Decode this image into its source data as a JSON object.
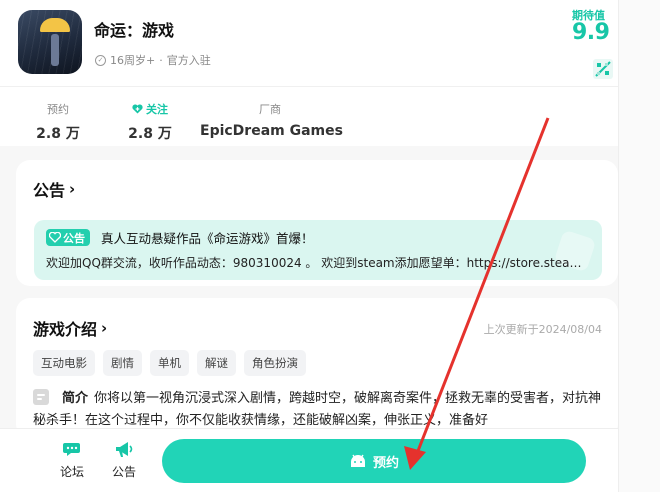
{
  "header": {
    "title": "命运：游戏",
    "age_rating": "16周岁+",
    "separator": "·",
    "official": "官方入驻",
    "rating_label": "期待值",
    "rating_value": "9.9"
  },
  "stats": [
    {
      "label": "预约",
      "value": "2.8 万"
    },
    {
      "label": "关注",
      "value": "2.8 万"
    },
    {
      "label": "厂商",
      "value": "EpicDream Games"
    }
  ],
  "notice": {
    "title": "公告",
    "badge": "公告",
    "headline": "真人互动悬疑作品《命运游戏》首爆！",
    "body": "欢迎加QQ群交流，收听作品动态：980310024 。 欢迎到steam添加愿望单：https://store.steampowered.com/app/"
  },
  "intro": {
    "title": "游戏介绍",
    "updated": "上次更新于2024/08/04",
    "tags": [
      "互动电影",
      "剧情",
      "单机",
      "解谜",
      "角色扮演"
    ],
    "label": "简介",
    "text": "你将以第一视角沉浸式深入剧情，跨越时空，破解离奇案件，拯救无辜的受害者，对抗神秘杀手！在这个过程中，你不仅能收获情缘，还能破解凶案，伸张正义，准备好"
  },
  "bottom": {
    "forum": "论坛",
    "notice": "公告",
    "reserve": "预约"
  },
  "colors": {
    "accent": "#21d4b7",
    "arrow": "#e5322d"
  }
}
